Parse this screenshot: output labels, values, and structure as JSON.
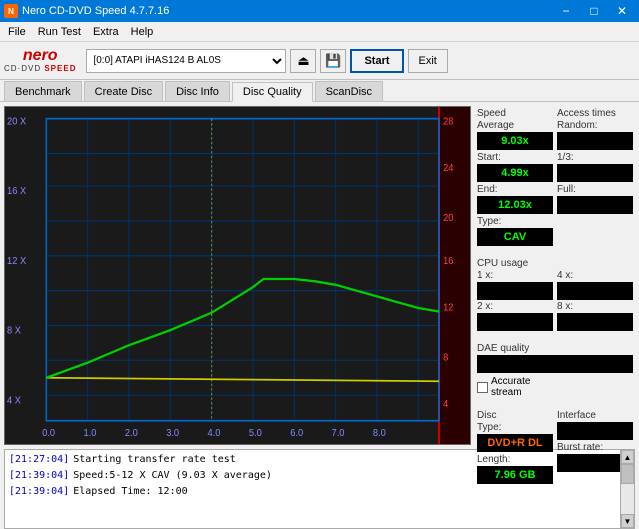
{
  "titleBar": {
    "title": "Nero CD-DVD Speed 4.7.7.16",
    "minimizeLabel": "−",
    "maximizeLabel": "□",
    "closeLabel": "✕"
  },
  "menuBar": {
    "items": [
      "File",
      "Run Test",
      "Extra",
      "Help"
    ]
  },
  "toolbar": {
    "driveLabel": "[0:0]  ATAPI iHAS124  B AL0S",
    "startLabel": "Start",
    "exitLabel": "Exit"
  },
  "tabs": [
    {
      "label": "Benchmark",
      "active": false
    },
    {
      "label": "Create Disc",
      "active": false
    },
    {
      "label": "Disc Info",
      "active": false
    },
    {
      "label": "Disc Quality",
      "active": true
    },
    {
      "label": "ScanDisc",
      "active": false
    }
  ],
  "chart": {
    "yAxisLeft": [
      "20 X",
      "16 X",
      "12 X",
      "8 X",
      "4 X"
    ],
    "yAxisRight": [
      "28",
      "24",
      "20",
      "16",
      "12",
      "8",
      "4"
    ],
    "xAxis": [
      "0.0",
      "1.0",
      "2.0",
      "3.0",
      "4.0",
      "5.0",
      "6.0",
      "7.0",
      "8.0"
    ]
  },
  "rightPanel": {
    "speedLabel": "Speed",
    "averageLabel": "Average",
    "averageValue": "9.03x",
    "startLabel": "Start:",
    "startValue": "4.99x",
    "endLabel": "End:",
    "endValue": "12.03x",
    "typeLabel": "Type:",
    "typeValue": "CAV",
    "accessTimesLabel": "Access times",
    "randomLabel": "Random:",
    "randomValue": "",
    "oneThirdLabel": "1/3:",
    "oneThirdValue": "",
    "fullLabel": "Full:",
    "fullValue": "",
    "cpuUsageLabel": "CPU usage",
    "cpu1xLabel": "1 x:",
    "cpu1xValue": "",
    "cpu2xLabel": "2 x:",
    "cpu2xValue": "",
    "cpu4xLabel": "4 x:",
    "cpu4xValue": "",
    "cpu8xLabel": "8 x:",
    "cpu8xValue": "",
    "daeQualityLabel": "DAE quality",
    "daeValue": "",
    "accurateStreamLabel": "Accurate",
    "accurateStream2": "stream",
    "discTypeLabel": "Disc",
    "discTypeLabelLine2": "Type:",
    "discTypeValue": "DVD+R DL",
    "lengthLabel": "Length:",
    "lengthValue": "7.96 GB",
    "interfaceLabel": "Interface",
    "burstRateLabel": "Burst rate:",
    "burstRateValue": ""
  },
  "log": {
    "entries": [
      {
        "time": "[21:27:04]",
        "text": "Starting transfer rate test"
      },
      {
        "time": "[21:39:04]",
        "text": "Speed:5-12 X CAV (9.03 X average)"
      },
      {
        "time": "[21:39:04]",
        "text": "Elapsed Time: 12:00"
      }
    ]
  }
}
